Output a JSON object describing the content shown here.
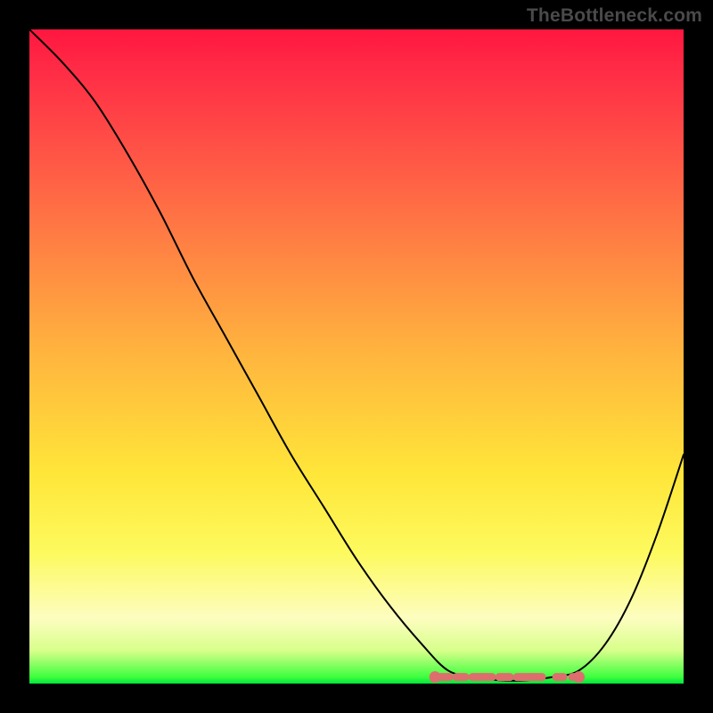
{
  "credit": "TheBottleneck.com",
  "chart_data": {
    "type": "line",
    "title": "",
    "xlabel": "",
    "ylabel": "",
    "xlim": [
      0,
      100
    ],
    "ylim": [
      0,
      100
    ],
    "series": [
      {
        "name": "curve",
        "x": [
          0,
          5,
          10,
          15,
          20,
          25,
          30,
          35,
          40,
          45,
          50,
          55,
          60,
          64,
          68,
          72,
          76,
          80,
          84,
          88,
          92,
          96,
          100
        ],
        "values": [
          100,
          95,
          89,
          81,
          72,
          62,
          53,
          44,
          35,
          27,
          19,
          12,
          6,
          2,
          1,
          0.5,
          0.5,
          1,
          2,
          6,
          13,
          23,
          35
        ]
      }
    ],
    "optimal_band": {
      "x_start": 62,
      "x_end": 84,
      "y": 1.0
    },
    "optimal_band_color": "#dd6e6e",
    "curve_color": "#000000"
  }
}
